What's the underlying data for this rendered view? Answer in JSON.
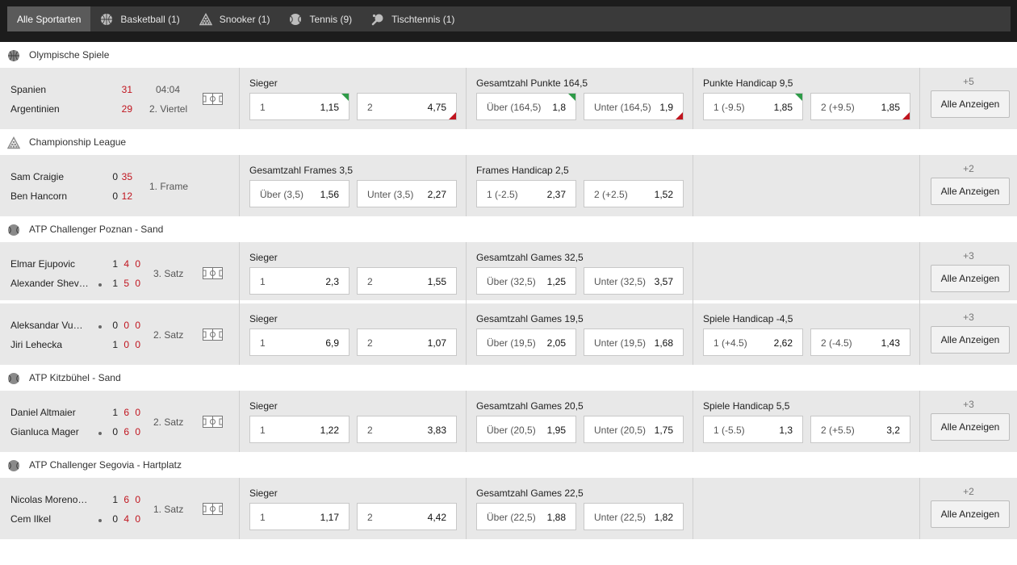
{
  "tabs": [
    {
      "label": "Alle Sportarten",
      "icon": ""
    },
    {
      "label": "Basketball (1)",
      "icon": "basketball-icon"
    },
    {
      "label": "Snooker (1)",
      "icon": "snooker-icon"
    },
    {
      "label": "Tennis (9)",
      "icon": "tennis-ball-icon"
    },
    {
      "label": "Tischtennis (1)",
      "icon": "table-tennis-icon"
    }
  ],
  "colors": {
    "accent_green": "#2e9b48",
    "accent_red": "#c0141e",
    "topbar": "#1c1c1c"
  },
  "more_button_label": "Alle Anzeigen",
  "leagues": [
    {
      "name": "Olympische Spiele",
      "icon": "basketball-icon",
      "matches": [
        {
          "p1": "Spanien",
          "p2": "Argentinien",
          "s1": [
            "31"
          ],
          "s2": [
            "29"
          ],
          "time": "04:04",
          "status": "2. Viertel",
          "more": "+5",
          "markets": [
            {
              "title": "Sieger",
              "odds": [
                {
                  "label": "1",
                  "value": "1,15",
                  "trend": "up"
                },
                {
                  "label": "2",
                  "value": "4,75",
                  "trend": "down"
                }
              ]
            },
            {
              "title": "Gesamtzahl Punkte 164,5",
              "odds": [
                {
                  "label": "Über (164,5)",
                  "value": "1,8",
                  "trend": "up"
                },
                {
                  "label": "Unter (164,5)",
                  "value": "1,9",
                  "trend": "down"
                }
              ]
            },
            {
              "title": "Punkte Handicap 9,5",
              "odds": [
                {
                  "label": "1 (-9.5)",
                  "value": "1,85",
                  "trend": "up"
                },
                {
                  "label": "2 (+9.5)",
                  "value": "1,85",
                  "trend": "down"
                }
              ]
            }
          ]
        }
      ]
    },
    {
      "name": "Championship League",
      "icon": "snooker-icon",
      "matches": [
        {
          "p1": "Sam Craigie",
          "p2": "Ben Hancorn",
          "s1": [
            "0",
            "35"
          ],
          "s2": [
            "0",
            "12"
          ],
          "time": "",
          "status": "1. Frame",
          "more": "+2",
          "markets": [
            {
              "title": "Gesamtzahl Frames 3,5",
              "odds": [
                {
                  "label": "Über (3,5)",
                  "value": "1,56"
                },
                {
                  "label": "Unter (3,5)",
                  "value": "2,27"
                }
              ]
            },
            {
              "title": "Frames Handicap 2,5",
              "odds": [
                {
                  "label": "1 (-2.5)",
                  "value": "2,37"
                },
                {
                  "label": "2 (+2.5)",
                  "value": "1,52"
                }
              ]
            }
          ]
        }
      ]
    },
    {
      "name": "ATP Challenger Poznan - Sand",
      "icon": "tennis-ball-icon",
      "matches": [
        {
          "p1": "Elmar Ejupovic",
          "p2": "Alexander Shev…",
          "s1": [
            "1",
            "4",
            "0"
          ],
          "s2": [
            "1",
            "5",
            "0"
          ],
          "serve": 2,
          "time": "",
          "status": "3. Satz",
          "more": "+3",
          "markets": [
            {
              "title": "Sieger",
              "odds": [
                {
                  "label": "1",
                  "value": "2,3"
                },
                {
                  "label": "2",
                  "value": "1,55"
                }
              ]
            },
            {
              "title": "Gesamtzahl Games 32,5",
              "odds": [
                {
                  "label": "Über (32,5)",
                  "value": "1,25"
                },
                {
                  "label": "Unter (32,5)",
                  "value": "3,57"
                }
              ]
            }
          ]
        },
        {
          "p1": "Aleksandar Vu…",
          "p2": "Jiri Lehecka",
          "s1": [
            "0",
            "0",
            "0"
          ],
          "s2": [
            "1",
            "0",
            "0"
          ],
          "serve": 1,
          "time": "",
          "status": "2. Satz",
          "more": "+3",
          "markets": [
            {
              "title": "Sieger",
              "odds": [
                {
                  "label": "1",
                  "value": "6,9"
                },
                {
                  "label": "2",
                  "value": "1,07"
                }
              ]
            },
            {
              "title": "Gesamtzahl Games 19,5",
              "odds": [
                {
                  "label": "Über (19,5)",
                  "value": "2,05"
                },
                {
                  "label": "Unter (19,5)",
                  "value": "1,68"
                }
              ]
            },
            {
              "title": "Spiele Handicap -4,5",
              "odds": [
                {
                  "label": "1 (+4.5)",
                  "value": "2,62"
                },
                {
                  "label": "2 (-4.5)",
                  "value": "1,43"
                }
              ]
            }
          ]
        }
      ]
    },
    {
      "name": "ATP Kitzbühel - Sand",
      "icon": "tennis-ball-icon",
      "matches": [
        {
          "p1": "Daniel Altmaier",
          "p2": "Gianluca Mager",
          "s1": [
            "1",
            "6",
            "0"
          ],
          "s2": [
            "0",
            "6",
            "0"
          ],
          "serve": 2,
          "time": "",
          "status": "2. Satz",
          "more": "+3",
          "markets": [
            {
              "title": "Sieger",
              "odds": [
                {
                  "label": "1",
                  "value": "1,22"
                },
                {
                  "label": "2",
                  "value": "3,83"
                }
              ]
            },
            {
              "title": "Gesamtzahl Games 20,5",
              "odds": [
                {
                  "label": "Über (20,5)",
                  "value": "1,95"
                },
                {
                  "label": "Unter (20,5)",
                  "value": "1,75"
                }
              ]
            },
            {
              "title": "Spiele Handicap 5,5",
              "odds": [
                {
                  "label": "1 (-5.5)",
                  "value": "1,3"
                },
                {
                  "label": "2 (+5.5)",
                  "value": "3,2"
                }
              ]
            }
          ]
        }
      ]
    },
    {
      "name": "ATP Challenger Segovia - Hartplatz",
      "icon": "tennis-ball-icon",
      "matches": [
        {
          "p1": "Nicolas Moreno…",
          "p2": "Cem Ilkel",
          "s1": [
            "1",
            "6",
            "0"
          ],
          "s2": [
            "0",
            "4",
            "0"
          ],
          "serve": 2,
          "time": "",
          "status": "1. Satz",
          "more": "+2",
          "markets": [
            {
              "title": "Sieger",
              "odds": [
                {
                  "label": "1",
                  "value": "1,17"
                },
                {
                  "label": "2",
                  "value": "4,42"
                }
              ]
            },
            {
              "title": "Gesamtzahl Games 22,5",
              "odds": [
                {
                  "label": "Über (22,5)",
                  "value": "1,88"
                },
                {
                  "label": "Unter (22,5)",
                  "value": "1,82"
                }
              ]
            }
          ]
        }
      ]
    }
  ]
}
